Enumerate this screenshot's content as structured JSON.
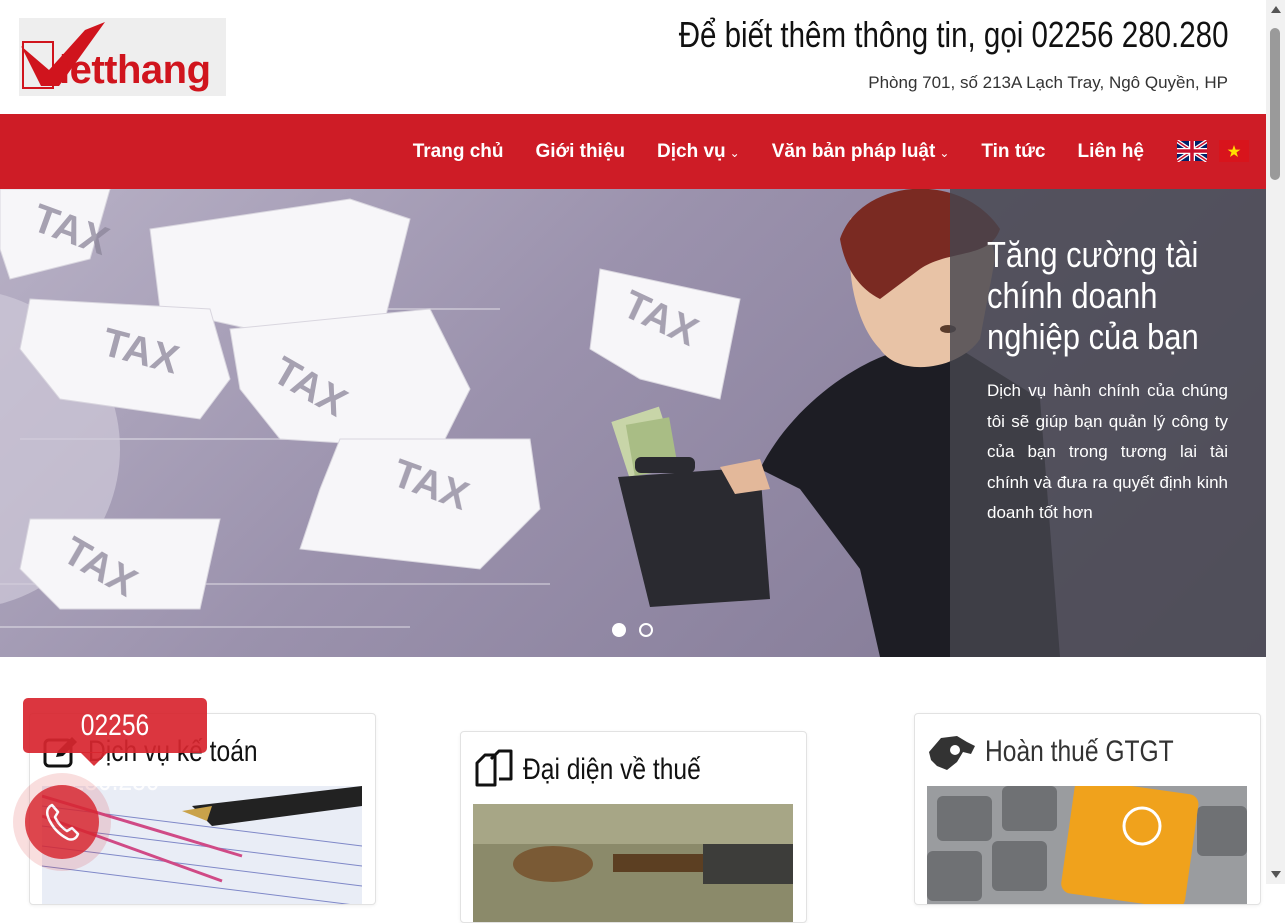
{
  "header": {
    "logo_text": "ietthang",
    "hotline_title": "Để biết thêm thông tin, gọi 02256 280.280",
    "address": "Phòng 701, số 213A Lạch Tray, Ngô Quyền, HP"
  },
  "nav": {
    "items": [
      {
        "label": "Trang chủ",
        "dropdown": false
      },
      {
        "label": "Giới thiệu",
        "dropdown": false
      },
      {
        "label": "Dịch vụ",
        "dropdown": true
      },
      {
        "label": "Văn bản pháp luật",
        "dropdown": true
      },
      {
        "label": "Tin tức",
        "dropdown": false
      },
      {
        "label": "Liên hệ",
        "dropdown": false
      }
    ],
    "flags": [
      "uk-flag-icon",
      "vietnam-flag-icon"
    ]
  },
  "hero": {
    "title": "Tăng cường tài chính doanh nghiệp của bạn",
    "text": "Dịch vụ hành chính của chúng tôi sẽ giúp bạn quản lý công ty của bạn trong tương lai tài chính và đưa ra quyết định kinh doanh tốt hơn",
    "slides": 2,
    "active_slide": 1,
    "paper_label": "TAX"
  },
  "services": [
    {
      "title": "Dịch vụ kế toán",
      "icon": "edit-icon"
    },
    {
      "title": "Đại diện về thuế",
      "icon": "copy-icon"
    },
    {
      "title": "Hoàn thuế GTGT",
      "icon": "sign-language-icon"
    }
  ],
  "floating_call": {
    "phone": "02256 280.280",
    "icon": "phone-icon"
  },
  "colors": {
    "brand_red": "#ce1c26",
    "hero_panel": "#46464e"
  }
}
